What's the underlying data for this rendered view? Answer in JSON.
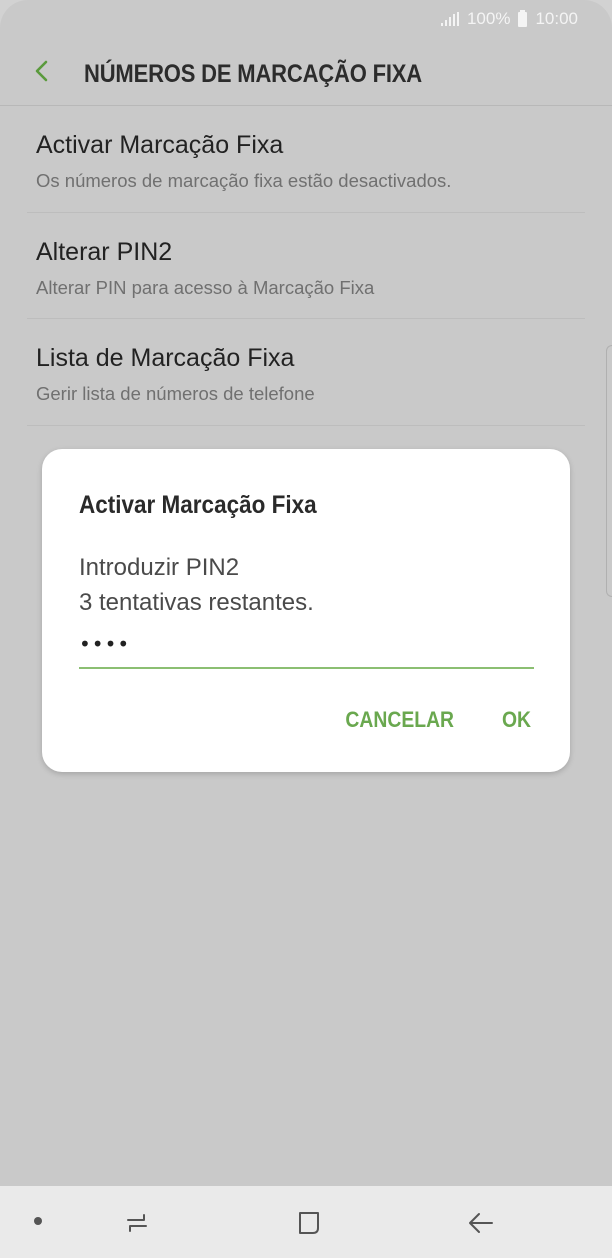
{
  "status_bar": {
    "battery_text": "100%",
    "time": "10:00"
  },
  "header": {
    "title": "NÚMEROS DE MARCAÇÃO FIXA",
    "back_icon": "chevron-left-icon"
  },
  "settings": {
    "items": [
      {
        "title": "Activar Marcação Fixa",
        "subtitle": "Os números de marcação fixa estão desactivados."
      },
      {
        "title": "Alterar PIN2",
        "subtitle": "Alterar PIN para acesso à Marcação Fixa"
      },
      {
        "title": "Lista de Marcação Fixa",
        "subtitle": "Gerir lista de números de telefone"
      }
    ]
  },
  "dialog": {
    "title": "Activar Marcação Fixa",
    "message_line1": "Introduzir PIN2",
    "message_line2": "3 tentativas restantes.",
    "pin_value": "••••",
    "cancel_label": "CANCELAR",
    "ok_label": "OK"
  },
  "nav_bar": {
    "icons": [
      "dot-icon",
      "recent-apps-icon",
      "home-icon",
      "back-icon"
    ]
  },
  "colors": {
    "accent": "#6aa84f",
    "back_arrow": "#5a9a3c",
    "background_dimmed": "#c9c9c9",
    "nav_bar": "#eaeaea"
  }
}
